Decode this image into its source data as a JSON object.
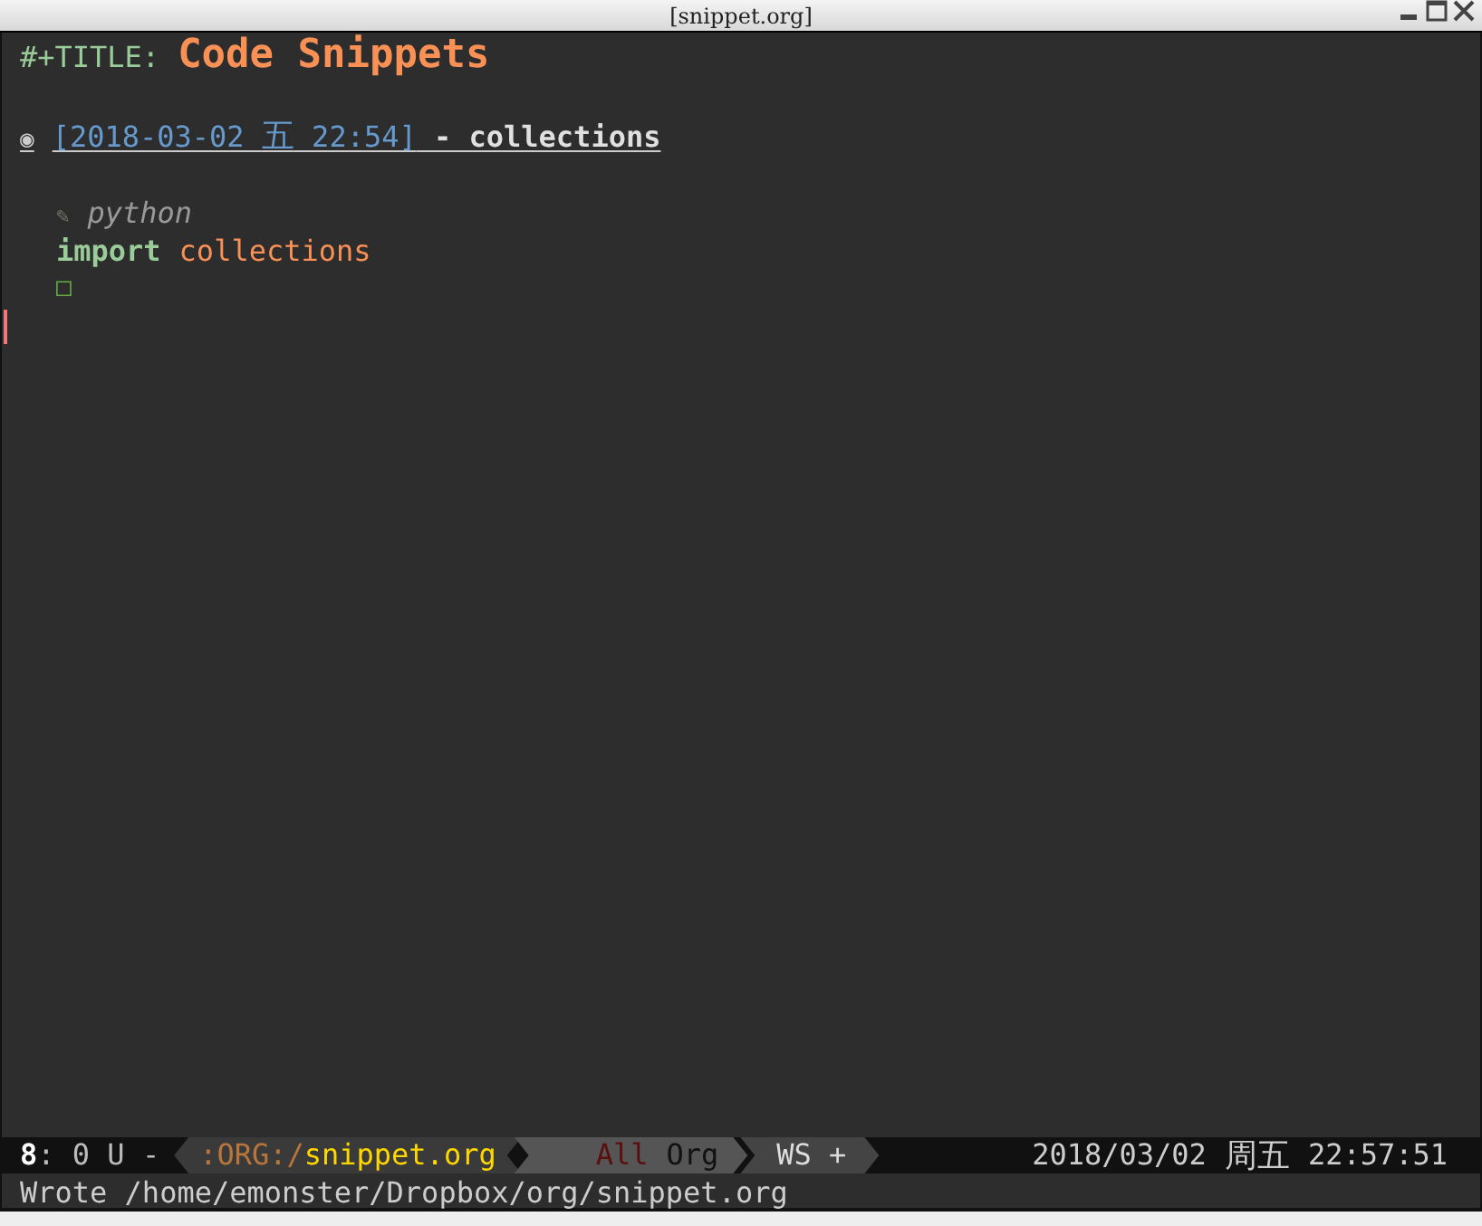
{
  "window": {
    "title": "[snippet.org]"
  },
  "editor": {
    "title_keyword": "#+TITLE:",
    "title": "Code Snippets",
    "heading": {
      "bullet": "◉",
      "timestamp_open": "[2018-03-02 ",
      "weekday": "五",
      "timestamp_close": " 22:54]",
      "text": " - collections"
    },
    "src_block": {
      "marker": "✎",
      "language": "python",
      "keyword": "import",
      "code": "collections",
      "end_marker": "□"
    }
  },
  "mode_line": {
    "window_number": "8",
    "state": ": 0 U -",
    "path_prefix": ":ORG:/",
    "buffer": "snippet.org",
    "position": "All",
    "mode": "Org",
    "minor": "WS +",
    "date": "2018/03/02",
    "weekday": "周五",
    "time": "22:57:51"
  },
  "echo_area": "Wrote /home/emonster/Dropbox/org/snippet.org"
}
